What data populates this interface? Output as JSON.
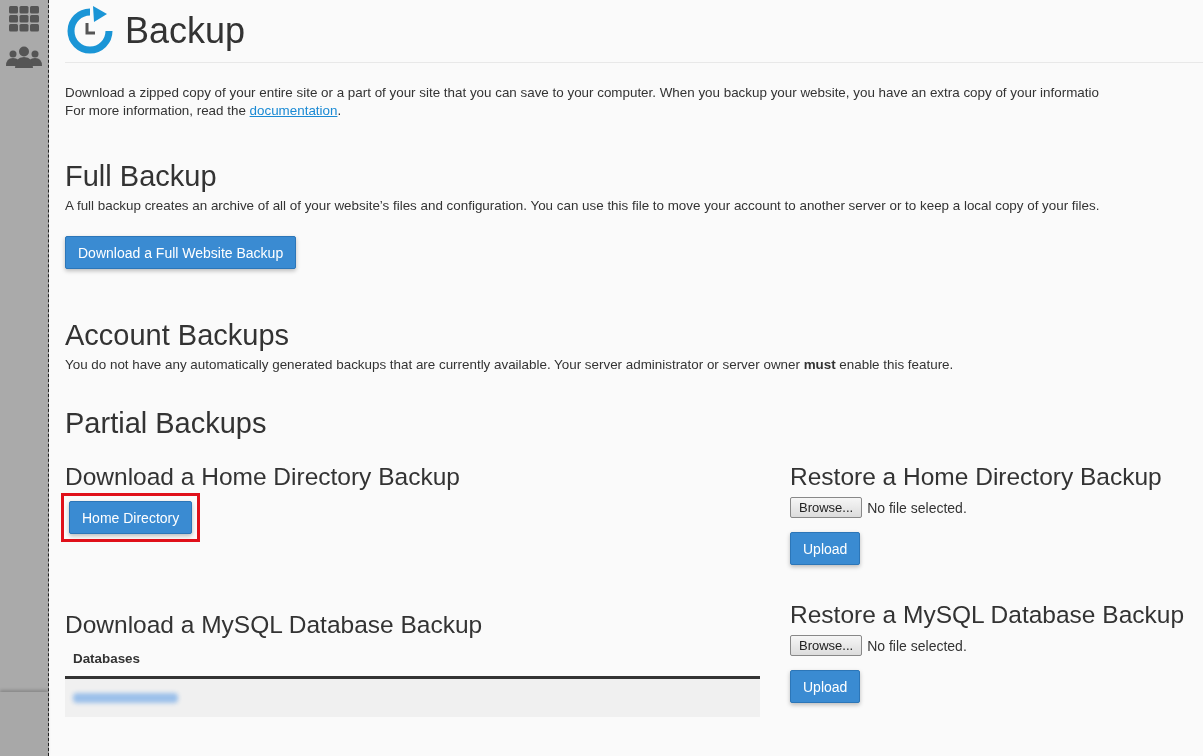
{
  "sidebar": {
    "items": [
      {
        "kind": "grid"
      },
      {
        "kind": "users"
      }
    ]
  },
  "page": {
    "title": "Backup",
    "intro": [
      "Download a zipped copy of your entire site or a part of your site that you can save to your computer. When you backup your website, you have an extra copy of your informatio"
    ],
    "intro_link_prefix": "For more information, read the ",
    "intro_link": "documentation",
    "intro_link_suffix": "."
  },
  "full_backup": {
    "heading": "Full Backup",
    "description": "A full backup creates an archive of all of your website’s files and configuration. You can use this file to move your account to another server or to keep a local copy of your files.",
    "button": "Download a Full Website Backup"
  },
  "account_backups": {
    "heading": "Account Backups",
    "description": "You do not have any automatically generated backups that are currently available. Your server administrator or server owner **must** enable this feature."
  },
  "partial_backups": {
    "heading": "Partial Backups",
    "home_download": {
      "heading": "Download a Home Directory Backup",
      "button": "Home Directory",
      "highlighted": true
    },
    "home_restore": {
      "heading": "Restore a Home Directory Backup",
      "browse": "Browse...",
      "file_status": "No file selected.",
      "upload": "Upload"
    },
    "mysql_download": {
      "heading": "Download a MySQL Database Backup",
      "table": {
        "columns": [
          "Databases"
        ],
        "rows": [
          {
            "blurred": true
          }
        ]
      }
    },
    "mysql_restore": {
      "heading": "Restore a MySQL Database Backup",
      "browse": "Browse...",
      "file_status": "No file selected.",
      "upload": "Upload"
    }
  }
}
